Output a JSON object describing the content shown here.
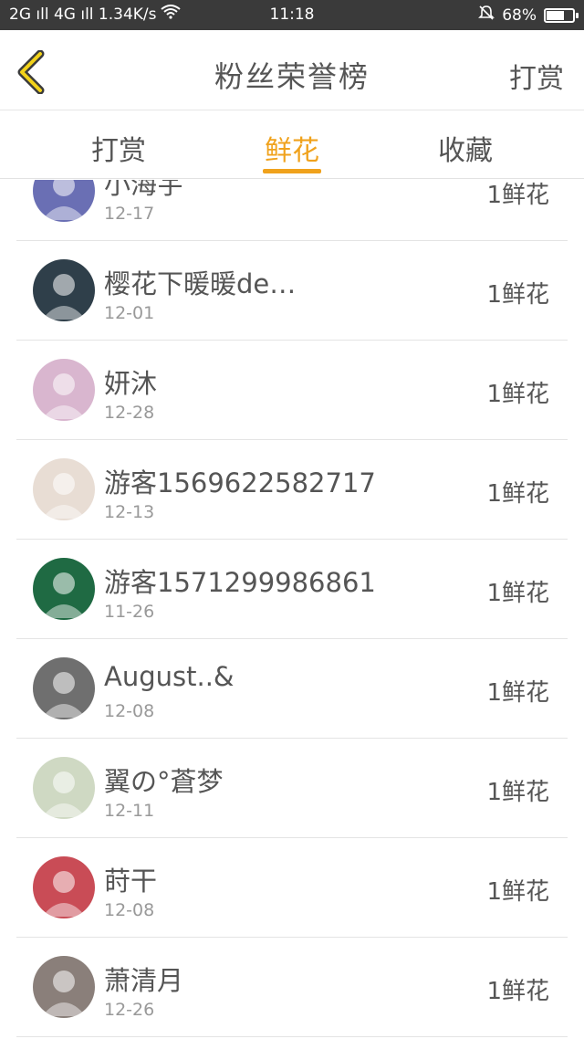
{
  "status_bar": {
    "left": "2G ıll 4G ıll 1.34K/s",
    "time": "11:18",
    "battery": "68%",
    "battery_level": 0.68
  },
  "header": {
    "title": "粉丝荣誉榜",
    "right_action": "打赏"
  },
  "tabs": [
    {
      "label": "打赏",
      "active": false
    },
    {
      "label": "鲜花",
      "active": true
    },
    {
      "label": "收藏",
      "active": false
    }
  ],
  "rows": [
    {
      "name": "小海宇",
      "date": "12-17",
      "gift": "1鲜花",
      "avatar_color": "#6a6fb4"
    },
    {
      "name": "樱花下暖暖de…",
      "date": "12-01",
      "gift": "1鲜花",
      "avatar_color": "#2f3f4a"
    },
    {
      "name": "妍沐",
      "date": "12-28",
      "gift": "1鲜花",
      "avatar_color": "#d9b6cf"
    },
    {
      "name": "游客1569622582717",
      "date": "12-13",
      "gift": "1鲜花",
      "avatar_color": "#e8ddd4"
    },
    {
      "name": "游客1571299986861",
      "date": "11-26",
      "gift": "1鲜花",
      "avatar_color": "#1f6a43"
    },
    {
      "name": "August..&",
      "date": "12-08",
      "gift": "1鲜花",
      "avatar_color": "#6f6f6f"
    },
    {
      "name": "翼の°蒼梦",
      "date": "12-11",
      "gift": "1鲜花",
      "avatar_color": "#cfd9c3"
    },
    {
      "name": "莳干",
      "date": "12-08",
      "gift": "1鲜花",
      "avatar_color": "#c94c56"
    },
    {
      "name": "萧清月",
      "date": "12-26",
      "gift": "1鲜花",
      "avatar_color": "#8a7f7a"
    }
  ]
}
